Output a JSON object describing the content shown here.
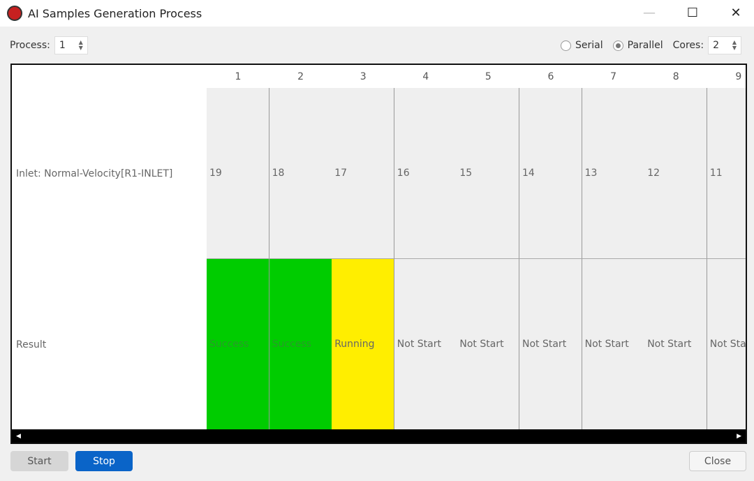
{
  "window": {
    "title": "AI Samples Generation Process",
    "logo_text": "AI"
  },
  "toolbar": {
    "process_label": "Process:",
    "process_value": "1",
    "serial_label": "Serial",
    "parallel_label": "Parallel",
    "mode": "Parallel",
    "cores_label": "Cores:",
    "cores_value": "2"
  },
  "grid": {
    "row_labels": [
      "Inlet: Normal-Velocity[R1-INLET]",
      "Result"
    ],
    "columns": [
      {
        "header": "1",
        "inlet": "19",
        "result": "Success",
        "color": "#00cc00"
      },
      {
        "header": "2",
        "inlet": "18",
        "result": "Success",
        "color": "#00cc00"
      },
      {
        "header": "3",
        "inlet": "17",
        "result": "Running",
        "color": "#ffee00"
      },
      {
        "header": "4",
        "inlet": "16",
        "result": "Not Start",
        "color": "#efefef"
      },
      {
        "header": "5",
        "inlet": "15",
        "result": "Not Start",
        "color": "#efefef"
      },
      {
        "header": "6",
        "inlet": "14",
        "result": "Not Start",
        "color": "#efefef"
      },
      {
        "header": "7",
        "inlet": "13",
        "result": "Not Start",
        "color": "#efefef"
      },
      {
        "header": "8",
        "inlet": "12",
        "result": "Not Start",
        "color": "#efefef"
      },
      {
        "header": "9",
        "inlet": "11",
        "result": "Not Start",
        "color": "#efefef"
      }
    ]
  },
  "buttons": {
    "start": "Start",
    "stop": "Stop",
    "close": "Close"
  },
  "colors": {
    "stop_button": "#0a64c8"
  }
}
